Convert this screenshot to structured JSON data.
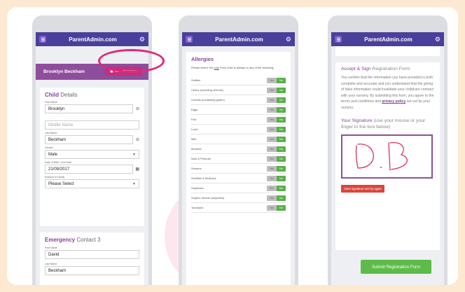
{
  "app": {
    "title": "ParentAdmin.com"
  },
  "phone1": {
    "child_name": "Brooklyn Beckham",
    "save_label": "Save Progress",
    "child_section": {
      "title_bold": "Child",
      "title_rest": " Details"
    },
    "fields": {
      "first_name_label": "First Name",
      "first_name_value": "Brooklyn",
      "middle_name_placeholder": "Middle Name",
      "last_name_label": "Last Name",
      "last_name_value": "Beckham",
      "gender_label": "Gender",
      "gender_value": "Male",
      "dob_label": "Date of Birth / Due Date",
      "dob_value": "21/09/2017",
      "position_label": "Position in Family",
      "position_value": "Please Select"
    },
    "emergency": {
      "title_bold": "Emergency",
      "title_rest": " Contact 3",
      "first_name_label": "First Name",
      "first_name_value": "David",
      "last_name_label": "Last Name",
      "last_name_value": "Beckham"
    }
  },
  "phone2": {
    "title": "Allergies",
    "intro_before": "Please select Yes ",
    "intro_only": "only",
    "intro_after": " if this child is allergic to any of the following:",
    "yes_label": "Yes",
    "no_label": "No",
    "allergens": [
      "Sulfites",
      "Celery (including celeriac)",
      "Cereals (containing gluten)",
      "Eggs",
      "Fish",
      "Lupin",
      "Milk",
      "Mustard",
      "Nuts & Peanuts",
      "Sesame",
      "Shellfish & Molluscs",
      "Soybeans",
      "Sulphur dioxide (sulphites)",
      "Tomatoes"
    ]
  },
  "phone3": {
    "title_bold": "Accept & Sign",
    "title_rest": " Registration Form",
    "para_before": "You confirm that the information you have provided is both complete and accurate and you understand that the giving of false information could invalidate your childcare contract with your nursery. By submitting this form, you agree to the terms and conditions and ",
    "privacy_link": "privacy policy",
    "para_after": " set out by your nursery.",
    "sig_bold": "Your Signature",
    "sig_rest": " (use your mouse or your finger in the box below)",
    "clear_label": "Clear signature and try again",
    "submit_label": "Submit Registration Form"
  },
  "colors": {
    "appbar": "#4b3f9c",
    "accent_purple": "#8e4e9d",
    "save_pink": "#c0307d",
    "highlight_ring": "#e2287b",
    "toggle_no": "#59b04a",
    "clear_red": "#d9453f",
    "submit_green": "#5dbb4a",
    "background": "#fde8d2"
  },
  "icons": {
    "menu": "menu-icon",
    "settings": "gear-icon",
    "save": "floppy-disk-icon",
    "clear_field": "clear-icon",
    "calendar": "calendar-icon",
    "dropdown": "chevron-down-icon"
  }
}
